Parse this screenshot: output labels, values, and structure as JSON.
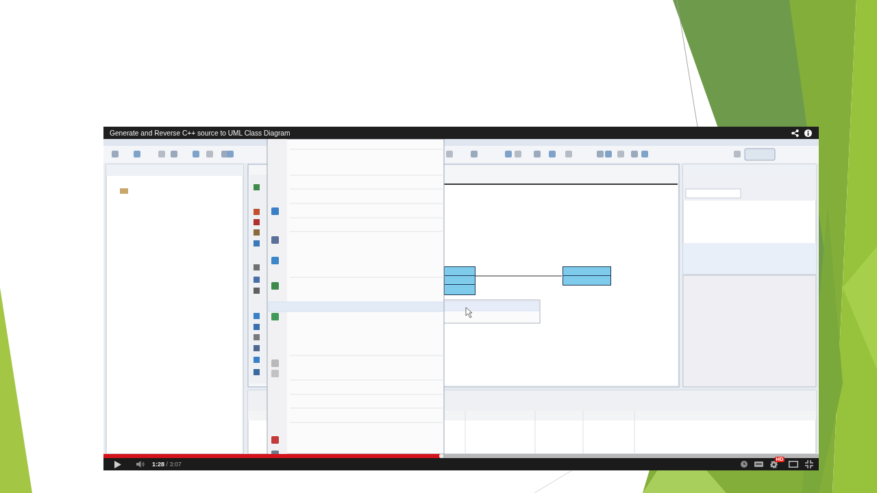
{
  "player": {
    "title": "Generate and Reverse C++ source to UML Class Diagram",
    "playing": false,
    "progress": {
      "level": 0.472
    },
    "time": "**1:28** / 3:07",
    "hd_badge": "HD"
  }
}
